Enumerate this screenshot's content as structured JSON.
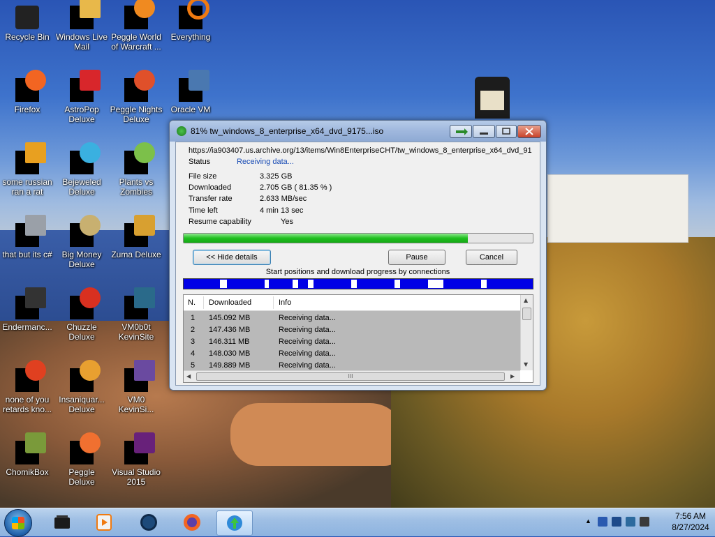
{
  "desktop": {
    "icons": [
      {
        "name": "recycle-bin-icon",
        "label": "Recycle Bin"
      },
      {
        "name": "windows-live-mail-icon",
        "label": "Windows Live Mail"
      },
      {
        "name": "peggle-world-of-warcraft-icon",
        "label": "Peggle World of Warcraft ..."
      },
      {
        "name": "everything-icon",
        "label": "Everything"
      },
      {
        "name": "firefox-icon",
        "label": "Firefox"
      },
      {
        "name": "astropop-deluxe-icon",
        "label": "AstroPop Deluxe"
      },
      {
        "name": "peggle-nights-deluxe-icon",
        "label": "Peggle Nights Deluxe"
      },
      {
        "name": "oracle-vm-icon",
        "label": "Oracle VM"
      },
      {
        "name": "some-russian-ran-a-rat-icon",
        "label": "some russian ran a rat"
      },
      {
        "name": "bejeweled-deluxe-icon",
        "label": "Bejeweled Deluxe"
      },
      {
        "name": "plants-vs-zombies-icon",
        "label": "Plants vs Zombies"
      },
      {
        "name": "that-but-its-csharp-icon",
        "label": "that but its c#"
      },
      {
        "name": "big-money-deluxe-icon",
        "label": "Big Money Deluxe"
      },
      {
        "name": "zuma-deluxe-icon",
        "label": "Zuma Deluxe"
      },
      {
        "name": "endermanc-icon",
        "label": "Endermanc..."
      },
      {
        "name": "chuzzle-deluxe-icon",
        "label": "Chuzzle Deluxe"
      },
      {
        "name": "vm0b0t-kevinsite-icon",
        "label": "VM0b0t KevinSite"
      },
      {
        "name": "none-of-you-retards-icon",
        "label": "none of you retards kno..."
      },
      {
        "name": "insaniquarium-deluxe-icon",
        "label": "Insaniquar... Deluxe"
      },
      {
        "name": "vm0-kevinsi-icon",
        "label": "VM0 KevinSi..."
      },
      {
        "name": "chomikbox-icon",
        "label": "ChomikBox"
      },
      {
        "name": "peggle-deluxe-icon",
        "label": "Peggle Deluxe"
      },
      {
        "name": "visual-studio-2015-icon",
        "label": "Visual Studio 2015"
      }
    ]
  },
  "dialog": {
    "title": "81% tw_windows_8_enterprise_x64_dvd_9175...iso",
    "url": "https://ia903407.us.archive.org/13/items/Win8EnterpriseCHT/tw_windows_8_enterprise_x64_dvd_91",
    "status_label": "Status",
    "status_value": "Receiving data...",
    "file_size_label": "File size",
    "file_size_value": "3.325  GB",
    "downloaded_label": "Downloaded",
    "downloaded_value": "2.705  GB  ( 81.35 % )",
    "transfer_rate_label": "Transfer rate",
    "transfer_rate_value": "2.633  MB/sec",
    "time_left_label": "Time left",
    "time_left_value": "4 min  13 sec",
    "resume_label": "Resume capability",
    "resume_value": "Yes",
    "progress_fraction": 0.8135,
    "hide_details_label": "<< Hide details",
    "pause_label": "Pause",
    "cancel_label": "Cancel",
    "connections_label": "Start positions and download progress by connections",
    "columns": {
      "n": "N.",
      "downloaded": "Downloaded",
      "info": "Info"
    },
    "connections": [
      {
        "n": "1",
        "downloaded": "145.092  MB",
        "info": "Receiving data..."
      },
      {
        "n": "2",
        "downloaded": "147.436  MB",
        "info": "Receiving data..."
      },
      {
        "n": "3",
        "downloaded": "146.311  MB",
        "info": "Receiving data..."
      },
      {
        "n": "4",
        "downloaded": "148.030  MB",
        "info": "Receiving data..."
      },
      {
        "n": "5",
        "downloaded": "149.889  MB",
        "info": "Receiving data..."
      }
    ],
    "hscroll_grip": "III"
  },
  "taskbar": {
    "items": [
      "start-button",
      "file-manager",
      "media-player",
      "globe-browser",
      "firefox",
      "internet-download-manager"
    ],
    "time": "7:56 AM",
    "date": "8/27/2024"
  },
  "colors": {
    "progress_green": "#1fbf1f",
    "connection_blue": "#0000e6",
    "status_blue": "#1a4db5"
  }
}
